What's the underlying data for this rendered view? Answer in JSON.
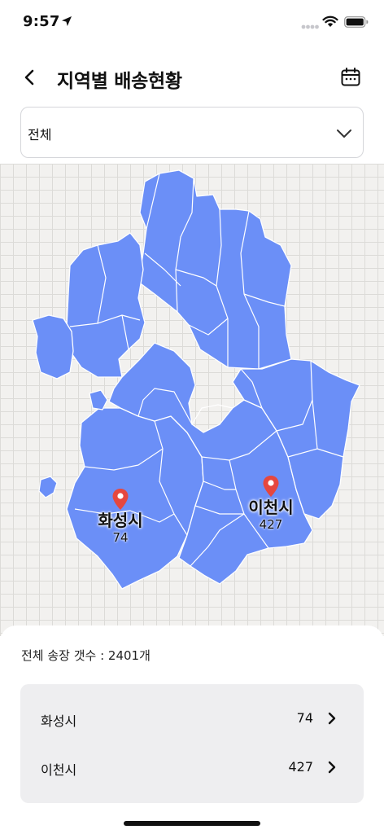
{
  "status_bar": {
    "time": "9:57",
    "icons": [
      "location-arrow-icon",
      "signal-icon",
      "wifi-icon",
      "battery-icon"
    ]
  },
  "header": {
    "title": "지역별 배송현황",
    "back_icon": "chevron-left-icon",
    "calendar_icon": "calendar-icon"
  },
  "filter": {
    "selected": "전체",
    "icon": "chevron-down-icon"
  },
  "map": {
    "region_fill": "#6b8ff7",
    "region_stroke": "#ffffff",
    "marker_color": "#e5473f",
    "markers": [
      {
        "name": "화성시",
        "count": "74"
      },
      {
        "name": "이천시",
        "count": "427"
      }
    ]
  },
  "summary": {
    "total_label": "전체 송장 갯수 : 2401개"
  },
  "list": [
    {
      "name": "화성시",
      "count": "74"
    },
    {
      "name": "이천시",
      "count": "427"
    }
  ],
  "colors": {
    "accent": "#6b8ff7",
    "list_background": "#eeeef0",
    "border": "#d5d6da"
  }
}
